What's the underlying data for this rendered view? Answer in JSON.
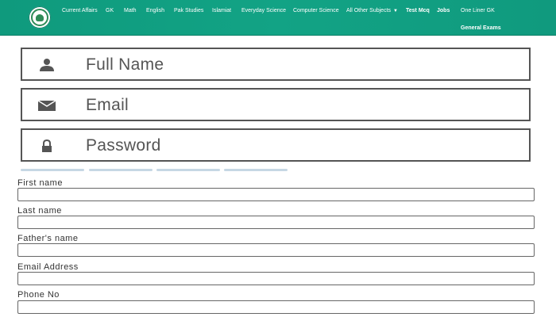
{
  "nav": {
    "items": [
      "Current Affairs",
      "GK",
      "Math",
      "English",
      "Pak Studies",
      "Islamiat",
      "Everyday Science",
      "Computer Science",
      "All Other Subjects"
    ],
    "bold_items": [
      "Test Mcq",
      "Jobs"
    ],
    "last_item": "One Liner GK",
    "second_row_item": "General Exams"
  },
  "signup": {
    "full_name": "Full Name",
    "email": "Email",
    "password": "Password"
  },
  "progress": {
    "segments_total": 4,
    "segments_filled": 0
  },
  "form": {
    "first_name": "First name",
    "last_name": "Last name",
    "fathers_name": "Father's name",
    "email_address": "Email Address",
    "phone_no": "Phone No"
  },
  "colors": {
    "nav_green": "#12a385",
    "segment": "#c6d7e4"
  },
  "icons": {
    "full_name": "user-icon",
    "email": "envelope-icon",
    "password": "lock-icon"
  }
}
